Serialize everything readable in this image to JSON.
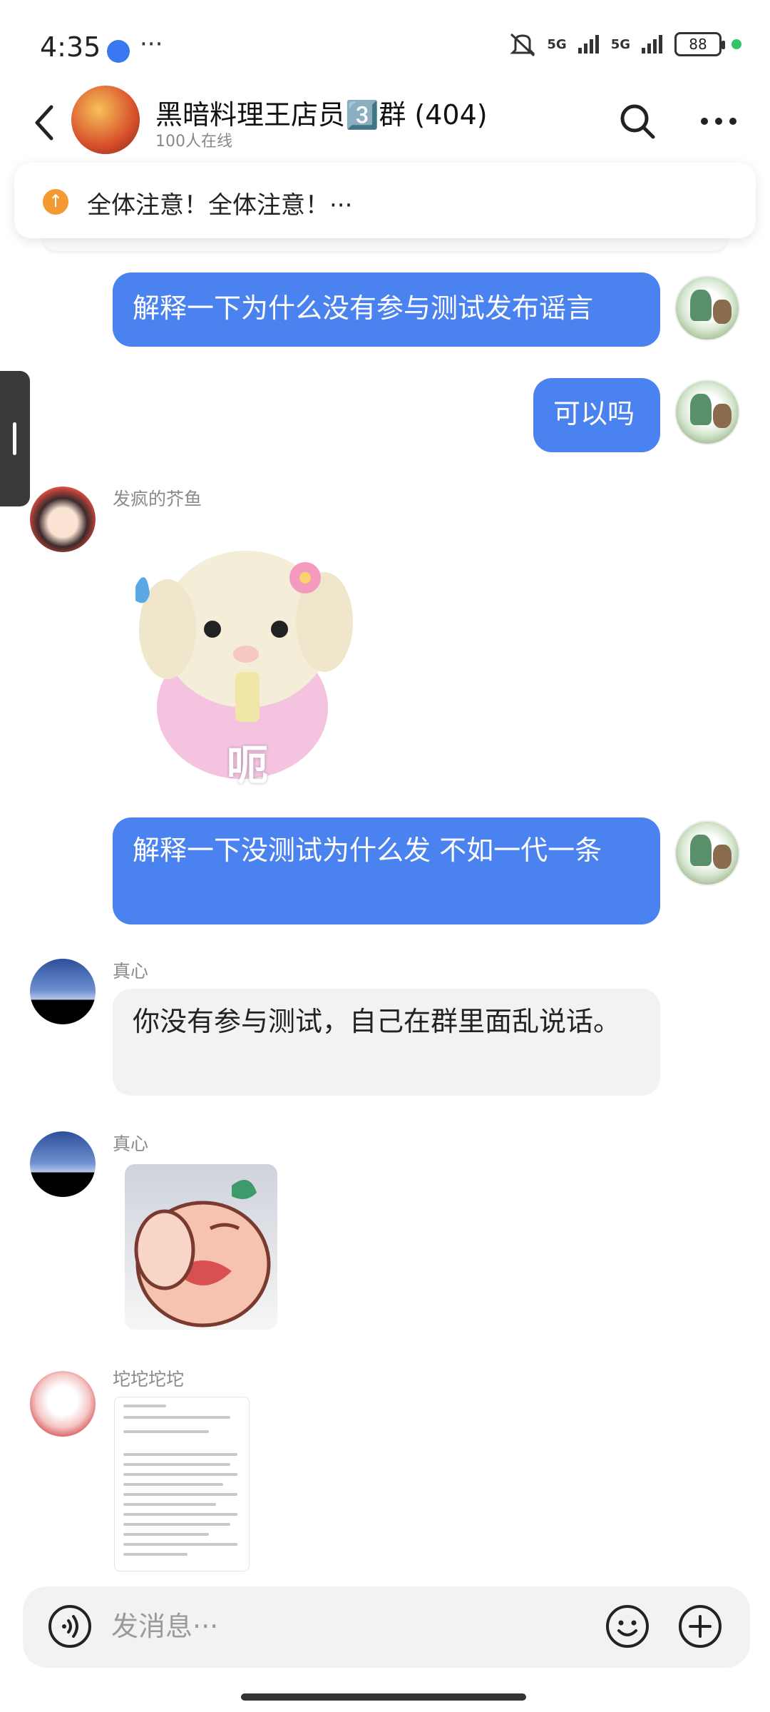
{
  "status_bar": {
    "time": "4:35",
    "dots": "···",
    "network_1": "5G",
    "network_2": "5G",
    "battery": "88"
  },
  "header": {
    "title": "黑暗料理王店员3️⃣群 (404)",
    "online": "100人在线"
  },
  "announcement": {
    "text": "全体注意！全体注意！···"
  },
  "messages": [
    {
      "direction": "out",
      "text": "解释一下为什么没有参与测试发布谣言"
    },
    {
      "direction": "out",
      "text": "可以吗"
    },
    {
      "direction": "in",
      "sender": "发疯的芥鱼",
      "type": "sticker",
      "caption": "呃"
    },
    {
      "direction": "out",
      "text": "解释一下没测试为什么发 不如一代一条"
    },
    {
      "direction": "in",
      "sender": "真心",
      "text": "你没有参与测试，自己在群里面乱说话。"
    },
    {
      "direction": "in",
      "sender": "真心",
      "type": "sticker"
    },
    {
      "direction": "in",
      "sender": "坨坨坨坨",
      "type": "image"
    }
  ],
  "input": {
    "placeholder": "发消息···"
  },
  "colors": {
    "outgoing_bubble": "#4a82f0",
    "incoming_bubble": "#f2f2f2",
    "announcement_icon": "#f39a33"
  }
}
